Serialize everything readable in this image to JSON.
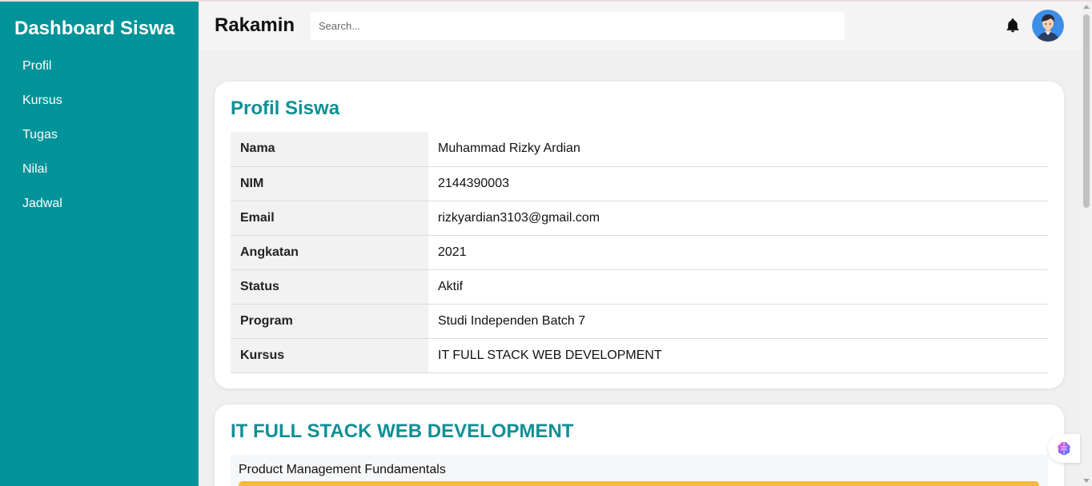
{
  "sidebar": {
    "title": "Dashboard Siswa",
    "items": [
      {
        "label": "Profil"
      },
      {
        "label": "Kursus"
      },
      {
        "label": "Tugas"
      },
      {
        "label": "Nilai"
      },
      {
        "label": "Jadwal"
      }
    ]
  },
  "header": {
    "brand": "Rakamin",
    "search_placeholder": "Search...",
    "notification_icon": "bell-icon",
    "avatar_icon": "user-avatar"
  },
  "profile": {
    "title": "Profil Siswa",
    "rows": [
      {
        "label": "Nama",
        "value": "Muhammad Rizky Ardian"
      },
      {
        "label": "NIM",
        "value": "2144390003"
      },
      {
        "label": "Email",
        "value": "rizkyardian3103@gmail.com"
      },
      {
        "label": "Angkatan",
        "value": "2021"
      },
      {
        "label": "Status",
        "value": "Aktif"
      },
      {
        "label": "Program",
        "value": "Studi Independen Batch 7"
      },
      {
        "label": "Kursus",
        "value": "IT FULL STACK WEB DEVELOPMENT"
      }
    ]
  },
  "course": {
    "title": "IT FULL STACK WEB DEVELOPMENT",
    "modules": [
      {
        "name": "Product Management Fundamentals"
      }
    ]
  },
  "colors": {
    "sidebar": "#009399",
    "accent_title": "#0f8f96",
    "progress": "#f3bb3b"
  },
  "extension_icon": "brain-icon"
}
